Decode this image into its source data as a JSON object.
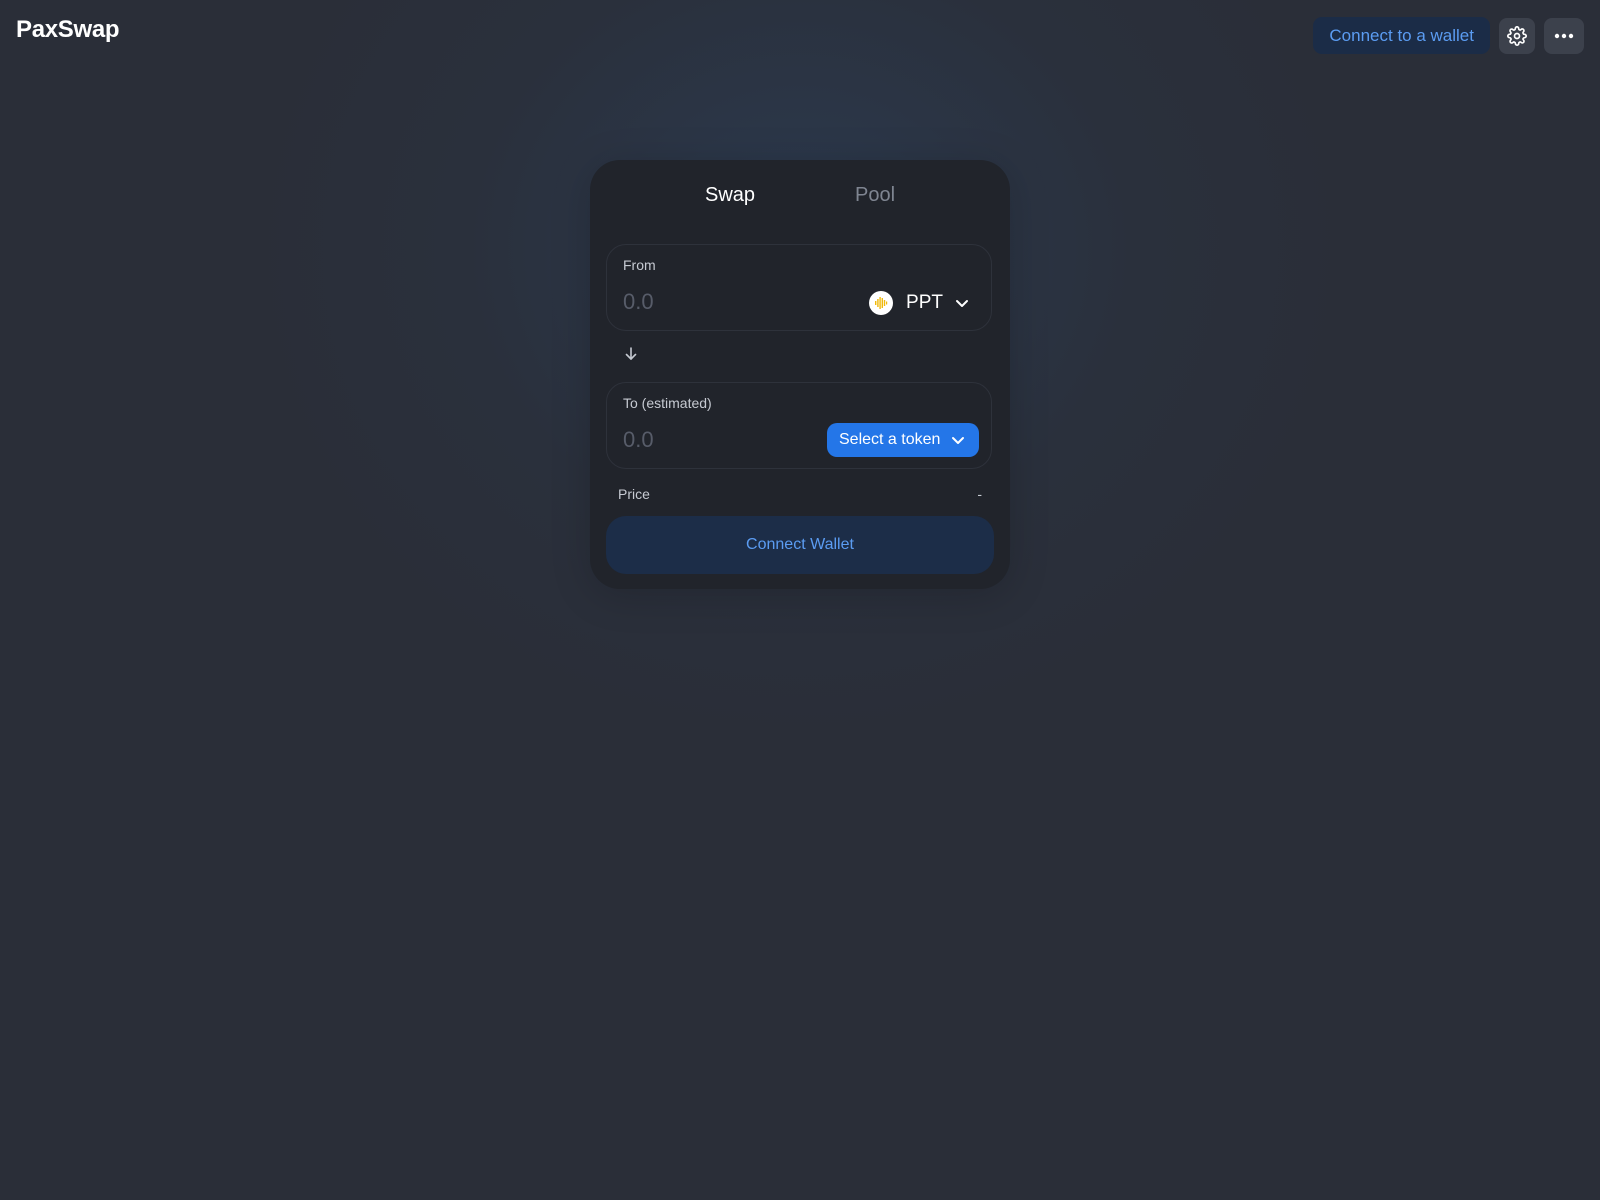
{
  "header": {
    "logo": "PaxSwap",
    "connect_label": "Connect to a wallet",
    "settings_icon": "gear-icon",
    "more_icon": "more-horizontal-icon"
  },
  "tabs": [
    {
      "label": "Swap",
      "active": true
    },
    {
      "label": "Pool",
      "active": false
    }
  ],
  "from": {
    "label": "From",
    "amount_placeholder": "0.0",
    "token": "PPT",
    "token_icon": "ppt-token-icon"
  },
  "to": {
    "label": "To (estimated)",
    "amount_placeholder": "0.0",
    "select_label": "Select a token"
  },
  "price": {
    "label": "Price",
    "value": "-"
  },
  "connect_button": "Connect Wallet",
  "colors": {
    "accent": "#2476e8",
    "accent_text": "#5b9cf2",
    "card_bg": "#21242b",
    "page_bg": "#2b2e38",
    "token_icon_color": "#f0b90b"
  }
}
